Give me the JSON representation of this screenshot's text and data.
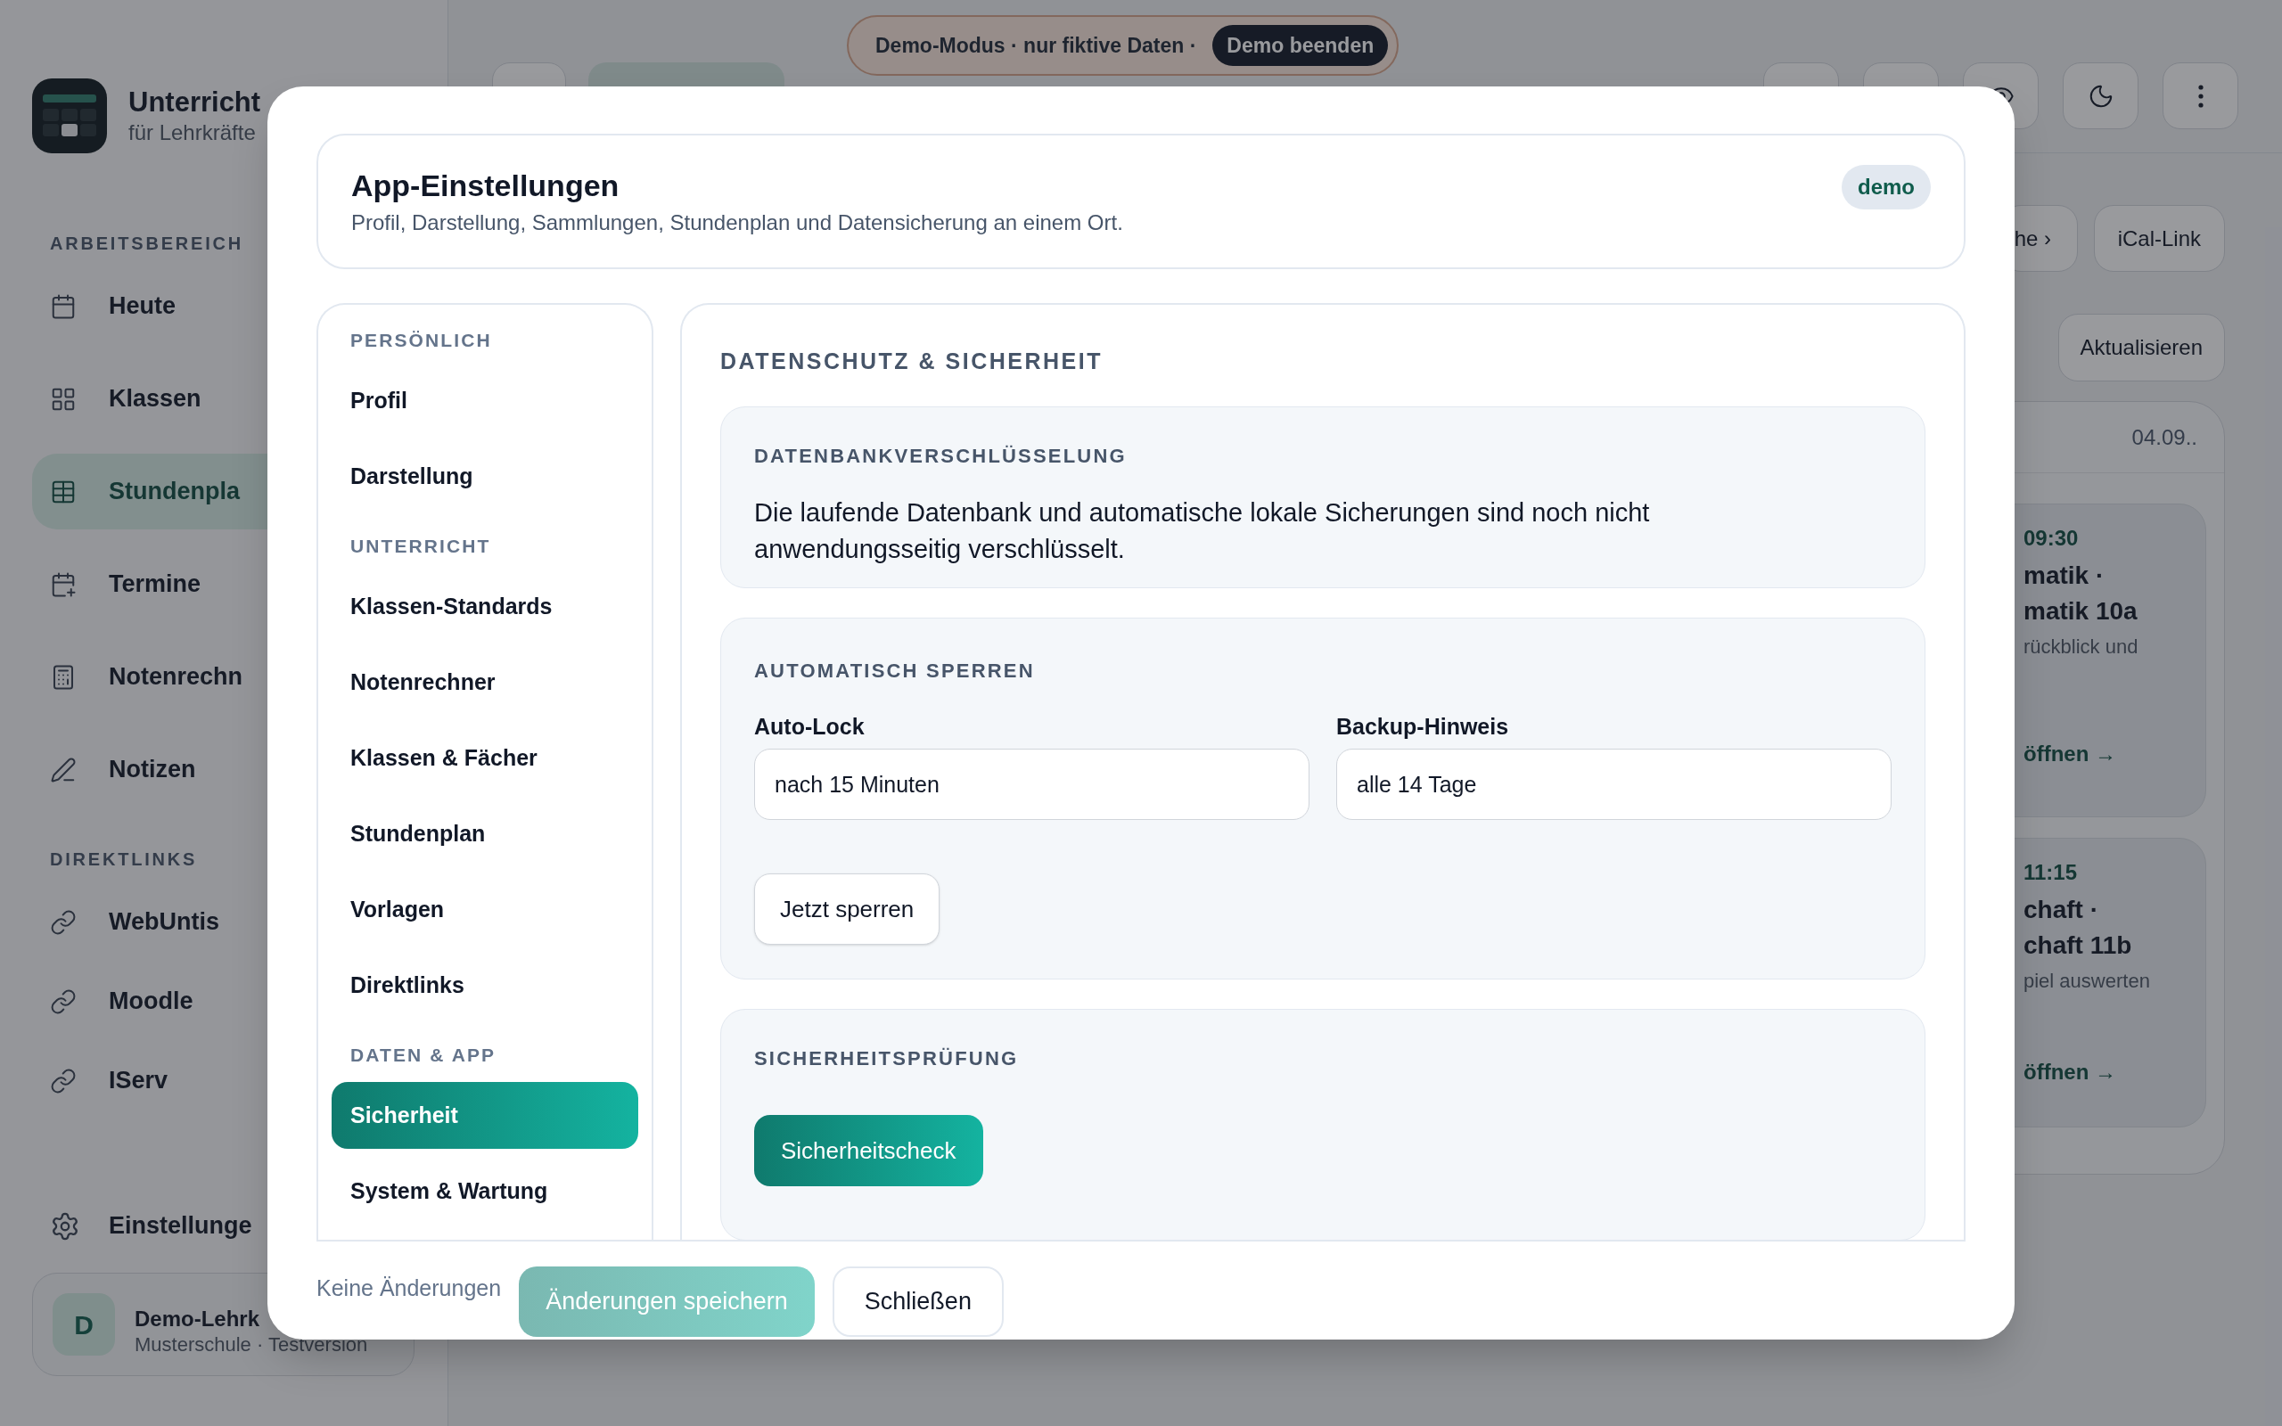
{
  "brand": {
    "title": "Unterricht",
    "subtitle": "für Lehrkräfte"
  },
  "sidebar": {
    "sections": [
      {
        "label": "ARBEITSBEREICH",
        "items": [
          {
            "label": "Heute",
            "selected": false
          },
          {
            "label": "Klassen",
            "selected": false
          },
          {
            "label": "Stundenpla",
            "selected": true
          },
          {
            "label": "Termine",
            "selected": false
          },
          {
            "label": "Notenrechn",
            "selected": false
          },
          {
            "label": "Notizen",
            "selected": false
          }
        ]
      },
      {
        "label": "DIREKTLINKS",
        "items": [
          {
            "label": "WebUntis",
            "selected": false
          },
          {
            "label": "Moodle",
            "selected": false
          },
          {
            "label": "IServ",
            "selected": false
          }
        ]
      }
    ],
    "settings": {
      "label": "Einstellunge"
    },
    "user": {
      "initial": "D",
      "name": "Demo-Lehrk",
      "detail": "Musterschule · Testversion"
    }
  },
  "demo_banner": {
    "text": "Demo-Modus · nur fiktive Daten ·",
    "button": "Demo beenden"
  },
  "main": {
    "actions": [
      "he ›",
      "iCal-Link"
    ],
    "refresh": "Aktualisieren",
    "panel": {
      "date": "04.09..",
      "lessons": [
        {
          "time": "09:30",
          "title": [
            "matik ·",
            "matik 10a"
          ],
          "note": "rückblick und",
          "link": "öffnen →"
        },
        {
          "time": "11:15",
          "title": [
            "chaft ·",
            "chaft 11b"
          ],
          "note": "piel auswerten",
          "link": "öffnen →"
        }
      ]
    }
  },
  "dialog": {
    "title": "App-Einstellungen",
    "subtitle": "Profil, Darstellung, Sammlungen, Stundenplan und Datensicherung an einem Ort.",
    "badge": "demo",
    "nav": [
      {
        "label": "PERSÖNLICH",
        "items": [
          {
            "label": "Profil",
            "selected": false
          },
          {
            "label": "Darstellung",
            "selected": false
          }
        ]
      },
      {
        "label": "UNTERRICHT",
        "items": [
          {
            "label": "Klassen-Standards",
            "selected": false
          },
          {
            "label": "Notenrechner",
            "selected": false
          },
          {
            "label": "Klassen & Fächer",
            "selected": false
          },
          {
            "label": "Stundenplan",
            "selected": false
          },
          {
            "label": "Vorlagen",
            "selected": false
          },
          {
            "label": "Direktlinks",
            "selected": false
          }
        ]
      },
      {
        "label": "DATEN & APP",
        "items": [
          {
            "label": "Sicherheit",
            "selected": true
          },
          {
            "label": "System & Wartung",
            "selected": false
          }
        ]
      }
    ],
    "section_title": "DATENSCHUTZ & SICHERHEIT",
    "cards": [
      {
        "kind": "notice",
        "title": "DATENBANKVERSCHLÜSSELUNG",
        "text": "Die laufende Datenbank und automatische lokale Sicherungen sind noch nicht anwendungsseitig verschlüsselt."
      },
      {
        "kind": "form",
        "title": "AUTOMATISCH SPERREN",
        "fields": [
          {
            "label": "Auto-Lock",
            "value": "nach 15 Minuten"
          },
          {
            "label": "Backup-Hinweis",
            "value": "alle 14 Tage"
          }
        ],
        "button": "Jetzt sperren"
      },
      {
        "kind": "action",
        "title": "SICHERHEITSPRÜFUNG",
        "button": "Sicherheitscheck"
      }
    ],
    "footer": {
      "status": "Keine Änderungen",
      "save": {
        "label": "Änderungen speichern",
        "disabled": true
      },
      "close": "Schließen"
    }
  }
}
